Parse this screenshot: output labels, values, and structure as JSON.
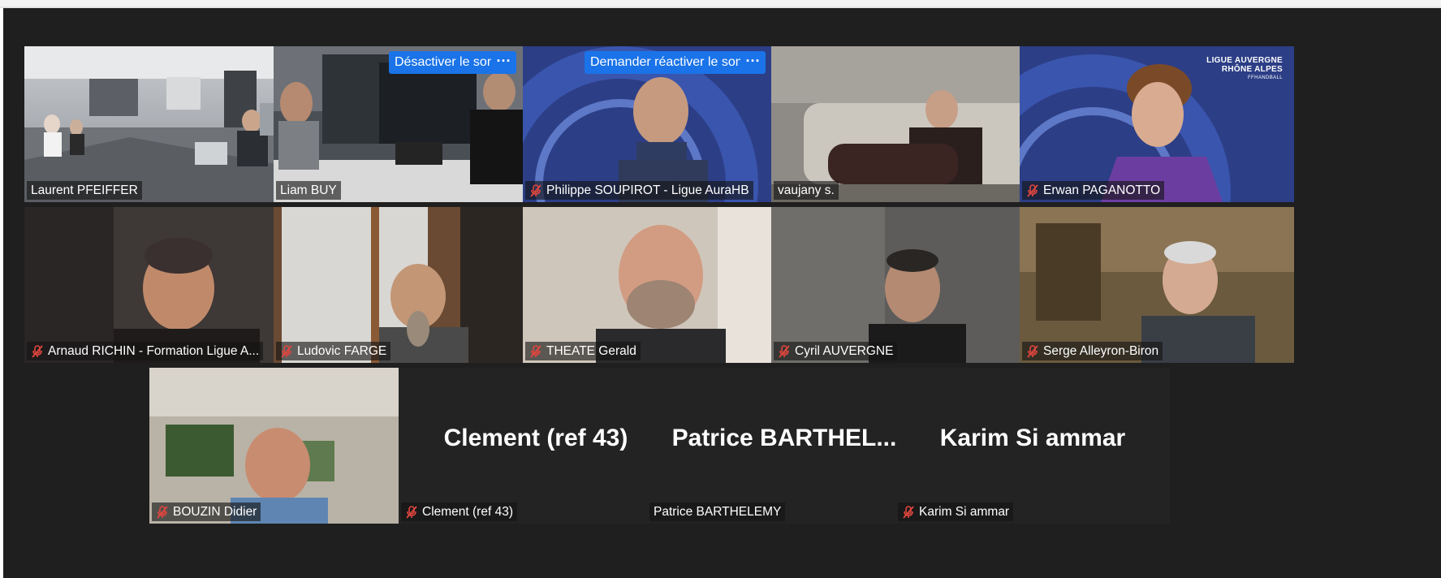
{
  "call": {
    "tiles": [
      {
        "name": "Laurent PFEIFFER",
        "muted": false,
        "active": true
      },
      {
        "name": "Liam BUY",
        "muted": false,
        "action": "Désactiver le son",
        "more": "···"
      },
      {
        "name": "Philippe SOUPIROT - Ligue AuraHB",
        "muted": true,
        "action": "Demander réactiver le son",
        "more": "···"
      },
      {
        "name": "vaujany s.",
        "muted": false
      },
      {
        "name": "Erwan PAGANOTTO",
        "muted": true,
        "brand_line1": "LIGUE AUVERGNE",
        "brand_line2": "RHÔNE ALPES",
        "brand_line3": "FFHANDBALL"
      },
      {
        "name": "Arnaud RICHIN - Formation Ligue A...",
        "muted": true
      },
      {
        "name": "Ludovic FARGE",
        "muted": true
      },
      {
        "name": "THEATE Gerald",
        "muted": true
      },
      {
        "name": "Cyril AUVERGNE",
        "muted": true
      },
      {
        "name": "Serge Alleyron-Biron",
        "muted": true
      },
      {
        "name": "BOUZIN Didier",
        "muted": true
      },
      {
        "name": "Clement (ref 43)",
        "display_name": "Clement (ref 43)",
        "muted": true,
        "video": false
      },
      {
        "name": "Patrice BARTHELEMY",
        "display_name": "Patrice  BARTHEL...",
        "muted": false,
        "video": false
      },
      {
        "name": "Karim Si ammar",
        "display_name": "Karim Si ammar",
        "muted": true,
        "video": false
      }
    ]
  },
  "colors": {
    "stage_bg": "#1f1f1f",
    "active_speaker_border": "#d7e565",
    "action_button": "#1a73e8",
    "muted_mic": "#e0463e"
  },
  "icons": {
    "muted": "muted-microphone-icon",
    "more": "more-options-icon"
  }
}
